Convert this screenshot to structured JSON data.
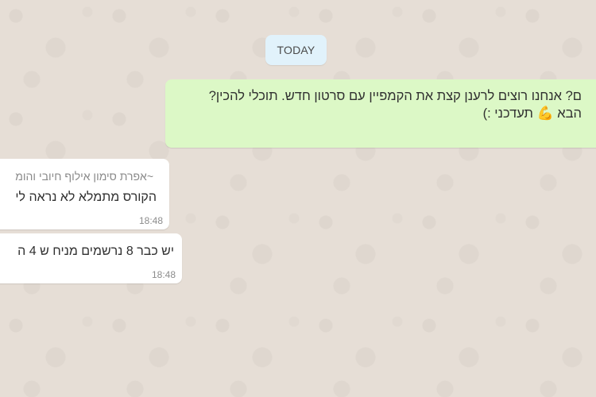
{
  "date_divider": {
    "label": "TODAY"
  },
  "messages": [
    {
      "direction": "outgoing",
      "line1": "ם? אנחנו רוצים לרענן קצת את הקמפיין עם סרטון חדש.  תוכלי להכין?",
      "line2_before_emoji": "הבא ",
      "emoji": "💪",
      "line2_after_emoji": " תעדכני :)"
    },
    {
      "direction": "incoming",
      "sender": "~אפרת סימון אילוף חיובי והומ",
      "text": "הקורס מתמלא לא נראה לי",
      "time": "18:48"
    },
    {
      "direction": "incoming",
      "text": "יש כבר 8 נרשמים מניח ש 4 ה",
      "time": "18:48"
    }
  ],
  "colors": {
    "chat_background": "#e6ded6",
    "outgoing_bubble": "#dcf8c6",
    "incoming_bubble": "#ffffff",
    "date_chip": "#e1f2fb"
  }
}
